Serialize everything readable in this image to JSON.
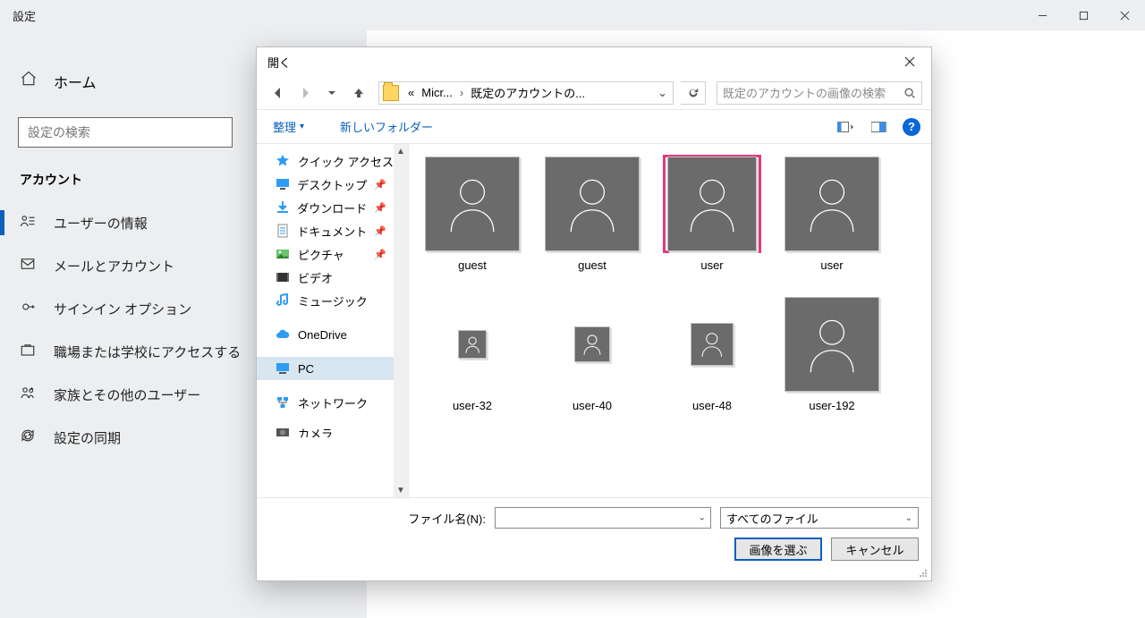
{
  "settings": {
    "title": "設定",
    "home": "ホーム",
    "search_placeholder": "設定の検索",
    "nav_heading": "アカウント",
    "nav": [
      {
        "id": "user-info",
        "label": "ユーザーの情報"
      },
      {
        "id": "mail",
        "label": "メールとアカウント"
      },
      {
        "id": "signin",
        "label": "サインイン オプション"
      },
      {
        "id": "work",
        "label": "職場または学校にアクセスする"
      },
      {
        "id": "family",
        "label": "家族とその他のユーザー"
      },
      {
        "id": "sync",
        "label": "設定の同期"
      }
    ]
  },
  "dialog": {
    "title": "開く",
    "breadcrumb": {
      "seg1_prefix": "«",
      "seg1": "Micr...",
      "seg2": "既定のアカウントの..."
    },
    "search_placeholder": "既定のアカウントの画像の検索",
    "toolbar": {
      "organize": "整理",
      "new_folder": "新しいフォルダー"
    },
    "tree": [
      {
        "id": "quick-access",
        "label": "クイック アクセス",
        "icon": "star"
      },
      {
        "id": "desktop",
        "label": "デスクトップ",
        "icon": "desktop",
        "pinned": true
      },
      {
        "id": "downloads",
        "label": "ダウンロード",
        "icon": "download",
        "pinned": true
      },
      {
        "id": "documents",
        "label": "ドキュメント",
        "icon": "document",
        "pinned": true
      },
      {
        "id": "pictures",
        "label": "ピクチャ",
        "icon": "picture",
        "pinned": true
      },
      {
        "id": "videos",
        "label": "ビデオ",
        "icon": "video"
      },
      {
        "id": "music",
        "label": "ミュージック",
        "icon": "music"
      },
      {
        "id": "onedrive",
        "label": "OneDrive",
        "icon": "cloud",
        "gap": true
      },
      {
        "id": "pc",
        "label": "PC",
        "icon": "pc",
        "selected": true,
        "gap": true
      },
      {
        "id": "network",
        "label": "ネットワーク",
        "icon": "network",
        "gap": true
      },
      {
        "id": "camera",
        "label": "カメラ",
        "icon": "camera",
        "gap": true,
        "cut": true
      }
    ],
    "files": [
      {
        "name": "guest",
        "size": 106,
        "selected": false
      },
      {
        "name": "guest",
        "size": 106,
        "selected": false
      },
      {
        "name": "user",
        "size": 106,
        "selected": true
      },
      {
        "name": "user",
        "size": 106,
        "selected": false
      },
      {
        "name": "user-32",
        "size": 32,
        "selected": false
      },
      {
        "name": "user-40",
        "size": 40,
        "selected": false
      },
      {
        "name": "user-48",
        "size": 48,
        "selected": false
      },
      {
        "name": "user-192",
        "size": 106,
        "selected": false
      }
    ],
    "bottom": {
      "filename_label": "ファイル名(N):",
      "filename_value": "",
      "type_label": "すべてのファイル",
      "open_btn": "画像を選ぶ",
      "cancel_btn": "キャンセル"
    }
  }
}
